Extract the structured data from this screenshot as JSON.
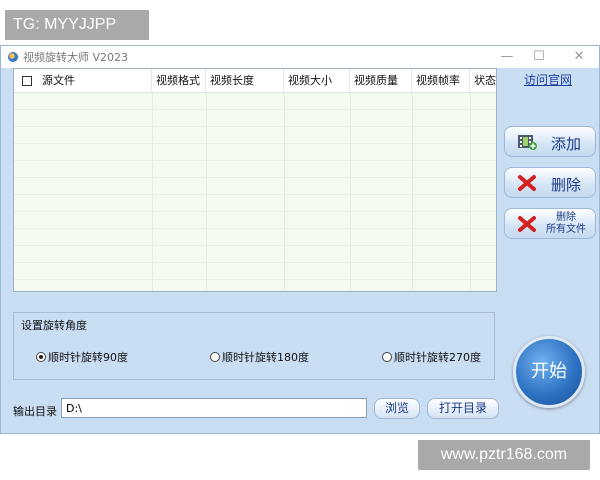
{
  "watermarks": {
    "top": "TG: MYYJJPP",
    "bottom": "www.pztr168.com"
  },
  "window": {
    "title": "视频旋转大师 V2023"
  },
  "file_list": {
    "columns": [
      "源文件",
      "视频格式",
      "视频长度",
      "视频大小",
      "视频质量",
      "视频帧率",
      "状态"
    ],
    "rows": []
  },
  "side": {
    "link": "访问官网",
    "add": "添加",
    "delete": "删除",
    "delete_all_line1": "删除",
    "delete_all_line2": "所有文件"
  },
  "rotation": {
    "group_title": "设置旋转角度",
    "options": [
      "顺时针旋转90度",
      "顺时针旋转180度",
      "顺时针旋转270度"
    ],
    "selected_index": 0
  },
  "output": {
    "label": "输出目录",
    "path": "D:\\",
    "browse": "浏览",
    "open_dir": "打开目录"
  },
  "start": "开始",
  "colors": {
    "window_bg": "#c9ddf3",
    "list_bg": "#f5faee",
    "accent": "#1a3a8a"
  },
  "icons": [
    "app-icon",
    "film-add-icon",
    "red-x-icon"
  ]
}
